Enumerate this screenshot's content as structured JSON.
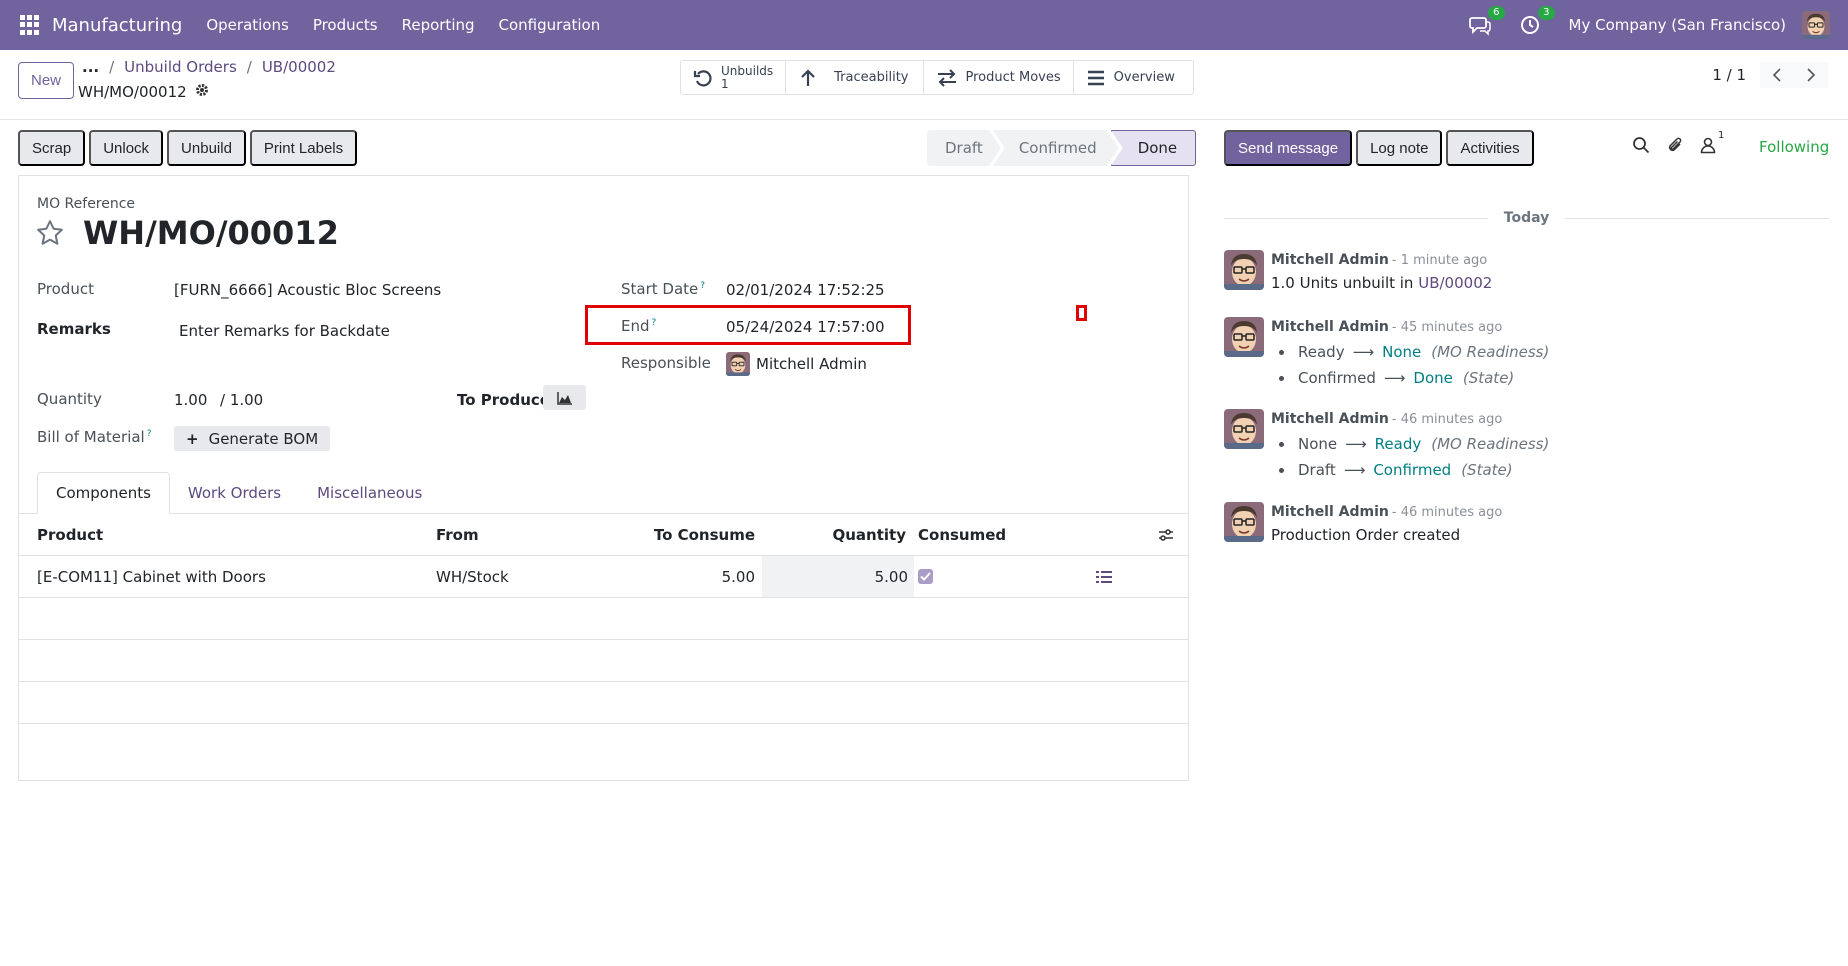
{
  "navbar": {
    "app_name": "Manufacturing",
    "menu": [
      "Operations",
      "Products",
      "Reporting",
      "Configuration"
    ],
    "messages_badge": "6",
    "activities_badge": "3",
    "company": "My Company (San Francisco)",
    "color": "#71639e"
  },
  "control": {
    "new_label": "New",
    "breadcrumb_more": "...",
    "breadcrumbs": [
      "Unbuild Orders",
      "UB/00002"
    ],
    "record_name": "WH/MO/00012",
    "smart_buttons": {
      "unbuilds_label": "Unbuilds",
      "unbuilds_count": "1",
      "traceability": "Traceability",
      "product_moves": "Product Moves",
      "overview": "Overview"
    },
    "pager": "1 / 1"
  },
  "statusbar": {
    "buttons": [
      "Scrap",
      "Unlock",
      "Unbuild",
      "Print Labels"
    ],
    "states": [
      "Draft",
      "Confirmed",
      "Done"
    ],
    "active_state": "Done"
  },
  "form": {
    "reference_label": "MO Reference",
    "reference": "WH/MO/00012",
    "product_label": "Product",
    "product_value": "[FURN_6666] Acoustic Bloc Screens",
    "remarks_label": "Remarks",
    "remarks_value": "Enter Remarks for Backdate",
    "quantity_label": "Quantity",
    "quantity_value": "1.00",
    "quantity_total": "/ 1.00",
    "to_produce_label": "To Produce",
    "bom_label": "Bill of Material",
    "generate_bom": "Generate BOM",
    "start_date_label": "Start Date",
    "start_date_value": "02/01/2024 17:52:25",
    "end_label": "End",
    "end_value": "05/24/2024 17:57:00",
    "responsible_label": "Responsible",
    "responsible_value": "Mitchell Admin",
    "help_mark": "?"
  },
  "tabs": [
    "Components",
    "Work Orders",
    "Miscellaneous"
  ],
  "table": {
    "headers": {
      "product": "Product",
      "from": "From",
      "to_consume": "To Consume",
      "quantity": "Quantity",
      "consumed": "Consumed"
    },
    "rows": [
      {
        "product": "[E-COM11] Cabinet with Doors",
        "from": "WH/Stock",
        "to_consume": "5.00",
        "quantity": "5.00"
      }
    ]
  },
  "chatter": {
    "send_message": "Send message",
    "log_note": "Log note",
    "activities": "Activities",
    "followers_count": "1",
    "following": "Following",
    "today": "Today",
    "messages": [
      {
        "author": "Mitchell Admin",
        "date": "- 1 minute ago",
        "text": "1.0 Units unbuilt in",
        "link": "UB/00002"
      },
      {
        "author": "Mitchell Admin",
        "date": "- 45 minutes ago",
        "tracking": [
          {
            "old": "Ready",
            "new": "None",
            "field": "(MO Readiness)"
          },
          {
            "old": "Confirmed",
            "new": "Done",
            "field": "(State)"
          }
        ]
      },
      {
        "author": "Mitchell Admin",
        "date": "- 46 minutes ago",
        "tracking": [
          {
            "old": "None",
            "new": "Ready",
            "field": "(MO Readiness)"
          },
          {
            "old": "Draft",
            "new": "Confirmed",
            "field": "(State)"
          }
        ]
      },
      {
        "author": "Mitchell Admin",
        "date": "- 46 minutes ago",
        "text": "Production Order created"
      }
    ]
  }
}
